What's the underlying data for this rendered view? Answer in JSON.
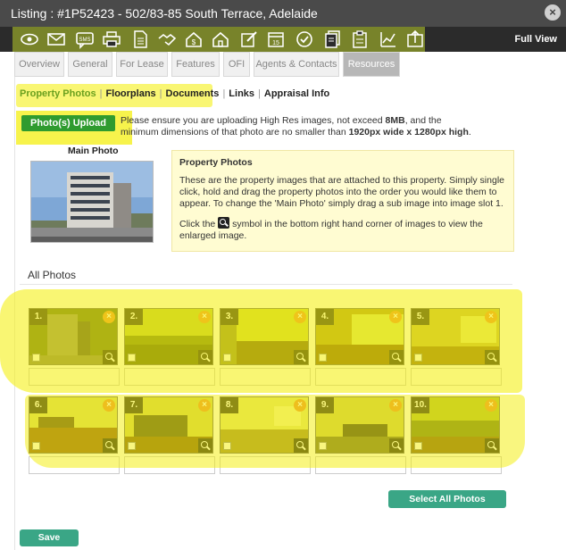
{
  "window": {
    "title": "Listing : #1P52423 - 502/83-85 South Terrace, Adelaide",
    "close_label": "×"
  },
  "toolbar": {
    "full_view_label": "Full View",
    "icons": [
      "eye-icon",
      "mail-icon",
      "sms-icon",
      "print-icon",
      "document-icon",
      "handshake-icon",
      "house-dollar-icon",
      "house-icon",
      "edit-icon",
      "calendar-icon",
      "check-circle-icon",
      "files-icon",
      "clipboard-icon",
      "chart-icon",
      "export-icon"
    ],
    "calendar_day": "15"
  },
  "tabs": [
    {
      "label": "Overview"
    },
    {
      "label": "General"
    },
    {
      "label": "For Lease"
    },
    {
      "label": "Features"
    },
    {
      "label": "OFI"
    },
    {
      "label": "Agents & Contacts"
    },
    {
      "label": "Resources",
      "active": true
    }
  ],
  "subnav": [
    {
      "label": "Property Photos",
      "active": true
    },
    {
      "label": "Floorplans"
    },
    {
      "label": "Documents"
    },
    {
      "label": "Links"
    },
    {
      "label": "Appraisal Info"
    }
  ],
  "upload": {
    "button_label": "Photo(s) Upload",
    "note_prefix": "Please ensure you are uploading High Res images, not exceed ",
    "note_size": "8MB",
    "note_middle": ", and the minimum dimensions of that photo are no smaller than ",
    "note_dims": "1920px wide x 1280px high",
    "note_suffix": "."
  },
  "main_photo": {
    "label": "Main Photo"
  },
  "info": {
    "title": "Property Photos",
    "para1": "These are the property images that are attached to this property. Simply single click, hold and drag the property photos into the order you would like them to appear. To change the 'Main Photo' simply drag a sub image into image slot 1.",
    "para2_before": "Click the",
    "para2_after": "symbol in the bottom right hand corner of images to view the enlarged image."
  },
  "gallery": {
    "label": "All Photos",
    "photos": [
      "1.",
      "2.",
      "3.",
      "4.",
      "5.",
      "6.",
      "7.",
      "8.",
      "9.",
      "10."
    ],
    "delete_symbol": "×"
  },
  "actions": {
    "select_all_label": "Select All Photos",
    "save_label": "Save"
  },
  "colors": {
    "accent_green": "#2f9b2f",
    "teal": "#3aa686",
    "highlight_yellow": "#f4ee00"
  }
}
